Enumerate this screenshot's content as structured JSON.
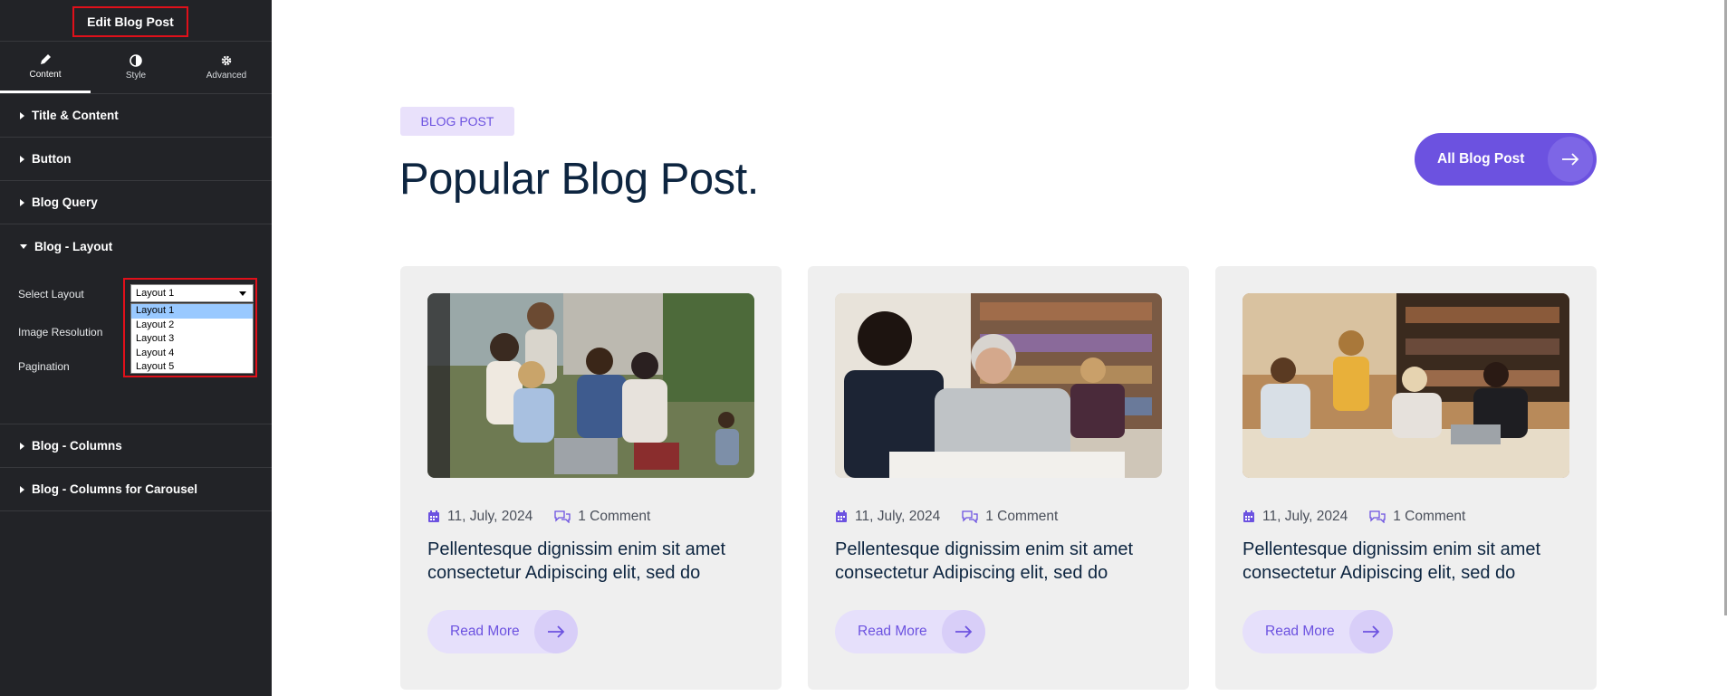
{
  "panel": {
    "title": "Edit Blog Post",
    "tabs": [
      {
        "label": "Content",
        "icon": "pencil-icon"
      },
      {
        "label": "Style",
        "icon": "contrast-icon"
      },
      {
        "label": "Advanced",
        "icon": "gear-icon"
      }
    ],
    "sections": {
      "title_content": "Title & Content",
      "button": "Button",
      "blog_query": "Blog Query",
      "blog_layout": "Blog - Layout",
      "blog_columns": "Blog - Columns",
      "blog_columns_carousel": "Blog - Columns for Carousel"
    },
    "layout_controls": {
      "select_layout_label": "Select Layout",
      "image_resolution_label": "Image Resolution",
      "pagination_label": "Pagination",
      "select_value": "Layout 1",
      "options": [
        "Layout 1",
        "Layout 2",
        "Layout 3",
        "Layout 4",
        "Layout 5"
      ]
    },
    "collapse_glyph": "‹"
  },
  "main": {
    "badge": "BLOG POST",
    "heading": "Popular Blog Post.",
    "all_button": "All Blog Post",
    "cards": [
      {
        "date": "11, July, 2024",
        "comments": "1 Comment",
        "title": "Pellentesque dignissim enim sit amet consectetur Adipiscing elit, sed do",
        "read_more": "Read More"
      },
      {
        "date": "11, July, 2024",
        "comments": "1 Comment",
        "title": "Pellentesque dignissim enim sit amet consectetur Adipiscing elit, sed do",
        "read_more": "Read More"
      },
      {
        "date": "11, July, 2024",
        "comments": "1 Comment",
        "title": "Pellentesque dignissim enim sit amet consectetur Adipiscing elit, sed do",
        "read_more": "Read More"
      }
    ]
  },
  "colors": {
    "accent": "#6c52e0",
    "panel_bg": "#222327",
    "highlight_border": "#e0101a",
    "heading": "#0d2540"
  }
}
